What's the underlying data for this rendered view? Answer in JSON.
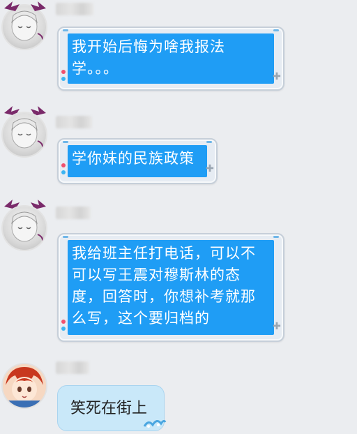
{
  "messages": [
    {
      "text": "我开始后悔为啥我报法学。。。"
    },
    {
      "text": "学你妹的民族政策"
    },
    {
      "text": "我给班主任打电话，可以不可以写王震对穆斯林的态度，回答时，你想补考就那么写，这个要归档的"
    },
    {
      "text": "笑死在街上"
    }
  ],
  "colors": {
    "bubble_blue": "#1f9df5",
    "background": "#ebedf0",
    "cloud_bubble": "#c9e8f9"
  }
}
